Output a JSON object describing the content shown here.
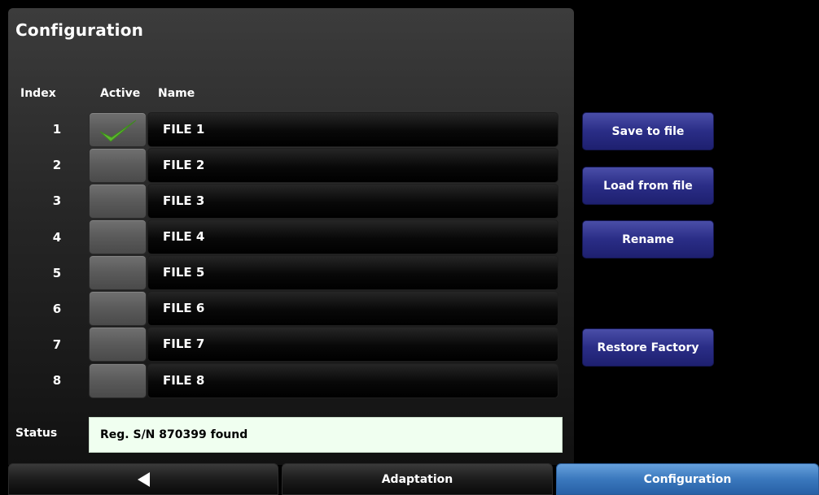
{
  "page": {
    "title": "Configuration"
  },
  "table": {
    "headers": {
      "index": "Index",
      "active": "Active",
      "name": "Name"
    },
    "rows": [
      {
        "index": "1",
        "name": "FILE 1",
        "active": true
      },
      {
        "index": "2",
        "name": "FILE 2",
        "active": false
      },
      {
        "index": "3",
        "name": "FILE 3",
        "active": false
      },
      {
        "index": "4",
        "name": "FILE 4",
        "active": false
      },
      {
        "index": "5",
        "name": "FILE 5",
        "active": false
      },
      {
        "index": "6",
        "name": "FILE 6",
        "active": false
      },
      {
        "index": "7",
        "name": "FILE 7",
        "active": false
      },
      {
        "index": "8",
        "name": "FILE 8",
        "active": false
      }
    ]
  },
  "actions": {
    "save": "Save to file",
    "load": "Load from file",
    "rename": "Rename",
    "restore": "Restore Factory"
  },
  "status": {
    "label": "Status",
    "message": "Reg. S/N 870399 found"
  },
  "bottom_tabs": {
    "back_icon": "back-arrow-icon",
    "adaptation": "Adaptation",
    "configuration": "Configuration",
    "active_tab": "Configuration"
  },
  "colors": {
    "button_blue": "#2a2d86",
    "active_tab_blue": "#3a78bd",
    "status_bg": "#f0fff0",
    "check_green": "#5cb82e"
  }
}
